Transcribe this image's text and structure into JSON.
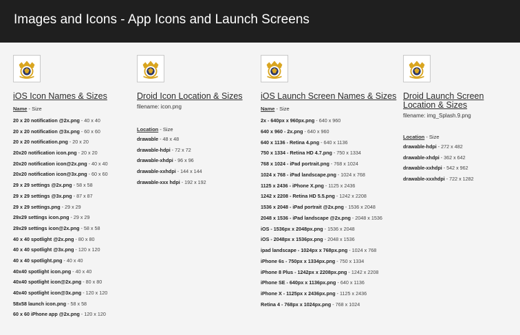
{
  "header": {
    "title": "Images and Icons - App Icons and Launch Screens"
  },
  "columns": [
    {
      "title": "iOS Icon Names & Sizes",
      "filename": "",
      "subhead": {
        "label": "Name",
        "suffix": " - Size"
      },
      "rows": [
        {
          "name": "20 x 20 notification @2x.png",
          "size": " - 40 x 40"
        },
        {
          "name": "20 x 20 notification @3x.png",
          "size": " - 60 x 60"
        },
        {
          "name": "20 x 20 notification.png",
          "size": " - 20 x 20"
        },
        {
          "name": "20x20 notification icon.png",
          "size": " - 20 x 20"
        },
        {
          "name": "20x20 notification icon@2x.png",
          "size": " - 40 x 40"
        },
        {
          "name": "20x20 notification icon@3x.png",
          "size": " - 60 x 60"
        },
        {
          "name": "29 x 29 settings @2x.png",
          "size": " - 58 x 58"
        },
        {
          "name": "29 x 29 settings @3x.png",
          "size": " - 87 x 87"
        },
        {
          "name": "29 x 29 settings.png",
          "size": " - 29 x 29"
        },
        {
          "name": "29x29 settings icon.png",
          "size": " - 29 x 29"
        },
        {
          "name": "29x29 settings icon@2x.png",
          "size": " - 58 x 58"
        },
        {
          "name": "40 x 40 spotlight @2x.png",
          "size": " - 80 x 80"
        },
        {
          "name": "40 x 40 spotlight @3x.png",
          "size": " - 120 x 120"
        },
        {
          "name": "40 x 40 spotlight.png",
          "size": " - 40 x 40"
        },
        {
          "name": "40x40 spotlight icon.png",
          "size": " - 40 x 40"
        },
        {
          "name": "40x40 spotlight icon@2x.png",
          "size": " - 80 x 80"
        },
        {
          "name": "40x40 spotlight icon@3x.png",
          "size": " - 120 x 120"
        },
        {
          "name": "58x58 launch icon.png",
          "size": " - 58 x 58"
        },
        {
          "name": "60 x 60 iPhone app @2x.png",
          "size": " - 120 x 120"
        }
      ]
    },
    {
      "title": "Droid Icon Location & Sizes",
      "filename": "filename: icon.png",
      "subhead": {
        "label": "Location",
        "suffix": " - Size"
      },
      "rows": [
        {
          "name": "drawable",
          "size": " - 48 x 48"
        },
        {
          "name": "drawable-hdpi",
          "size": " - 72 x 72"
        },
        {
          "name": "drawable-xhdpi",
          "size": " - 96 x 96"
        },
        {
          "name": "drawable-xxhdpi",
          "size": " - 144 x 144"
        },
        {
          "name": "drawable-xxx hdpi",
          "size": " - 192 x 192"
        }
      ]
    },
    {
      "title": "iOS Launch Screen Names & Sizes",
      "filename": "",
      "subhead": {
        "label": "Name",
        "suffix": " - Size"
      },
      "rows": [
        {
          "name": "2x - 640px x 960px.png",
          "size": " - 640 x 960"
        },
        {
          "name": "640 x 960 - 2x.png",
          "size": " - 640 x 960"
        },
        {
          "name": "640 x 1136 - Retina 4.png",
          "size": " - 640 x 1136"
        },
        {
          "name": "750 x 1334 - Retina HD 4.7.png",
          "size": " - 750 x 1334"
        },
        {
          "name": "768 x 1024 - iPad portrait.png",
          "size": " - 768 x 1024"
        },
        {
          "name": "1024 x 768 - iPad landscape.png",
          "size": " - 1024 x 768"
        },
        {
          "name": "1125 x 2436 - iPhone X.png",
          "size": " - 1125 x 2436"
        },
        {
          "name": "1242 x 2208 - Retina HD 5.5.png",
          "size": " - 1242 x 2208"
        },
        {
          "name": "1536 x 2048 - iPad portrait @2x.png",
          "size": " - 1536 x 2048"
        },
        {
          "name": "2048 x 1536 - iPad landscape @2x.png",
          "size": " - 2048 x 1536"
        },
        {
          "name": "iOS - 1536px x 2048px.png",
          "size": " - 1536 x 2048"
        },
        {
          "name": "iOS - 2048px x 1536px.png",
          "size": " - 2048 x 1536"
        },
        {
          "name": "ipad landscape - 1024px x 768px.png",
          "size": " - 1024 x 768"
        },
        {
          "name": "iPhone 6s - 750px x 1334px.png",
          "size": " - 750 x 1334"
        },
        {
          "name": "iPhone 8 Plus - 1242px x 2208px.png",
          "size": " - 1242 x 2208"
        },
        {
          "name": "iPhone SE - 640px x 1136px.png",
          "size": " - 640 x 1136"
        },
        {
          "name": "iPhone X - 1125px x 2436px.png",
          "size": " - 1125 x 2436"
        },
        {
          "name": "Retina 4 - 768px x 1024px.png",
          "size": " - 768 x 1024"
        }
      ]
    },
    {
      "title": "Droid Launch Screen Location & Sizes",
      "filename": "filename: img_Splash.9.png",
      "subhead": {
        "label": "Location",
        "suffix": " - Size"
      },
      "rows": [
        {
          "name": "drawable-hdpi",
          "size": " - 272 x 482"
        },
        {
          "name": "drawable-xhdpi",
          "size": " - 362 x 642"
        },
        {
          "name": "drawable-xxhdpi",
          "size": " - 542 x 962"
        },
        {
          "name": "drawable-xxxhdpi",
          "size": " - 722 x 1282"
        }
      ]
    }
  ],
  "colors": {
    "header_bg": "#1f1f1f",
    "page_bg": "#f4f4f4",
    "logo_gold": "#d9a520",
    "logo_navy": "#2a3566"
  },
  "icons": {
    "logo": "crest-logo-icon"
  }
}
